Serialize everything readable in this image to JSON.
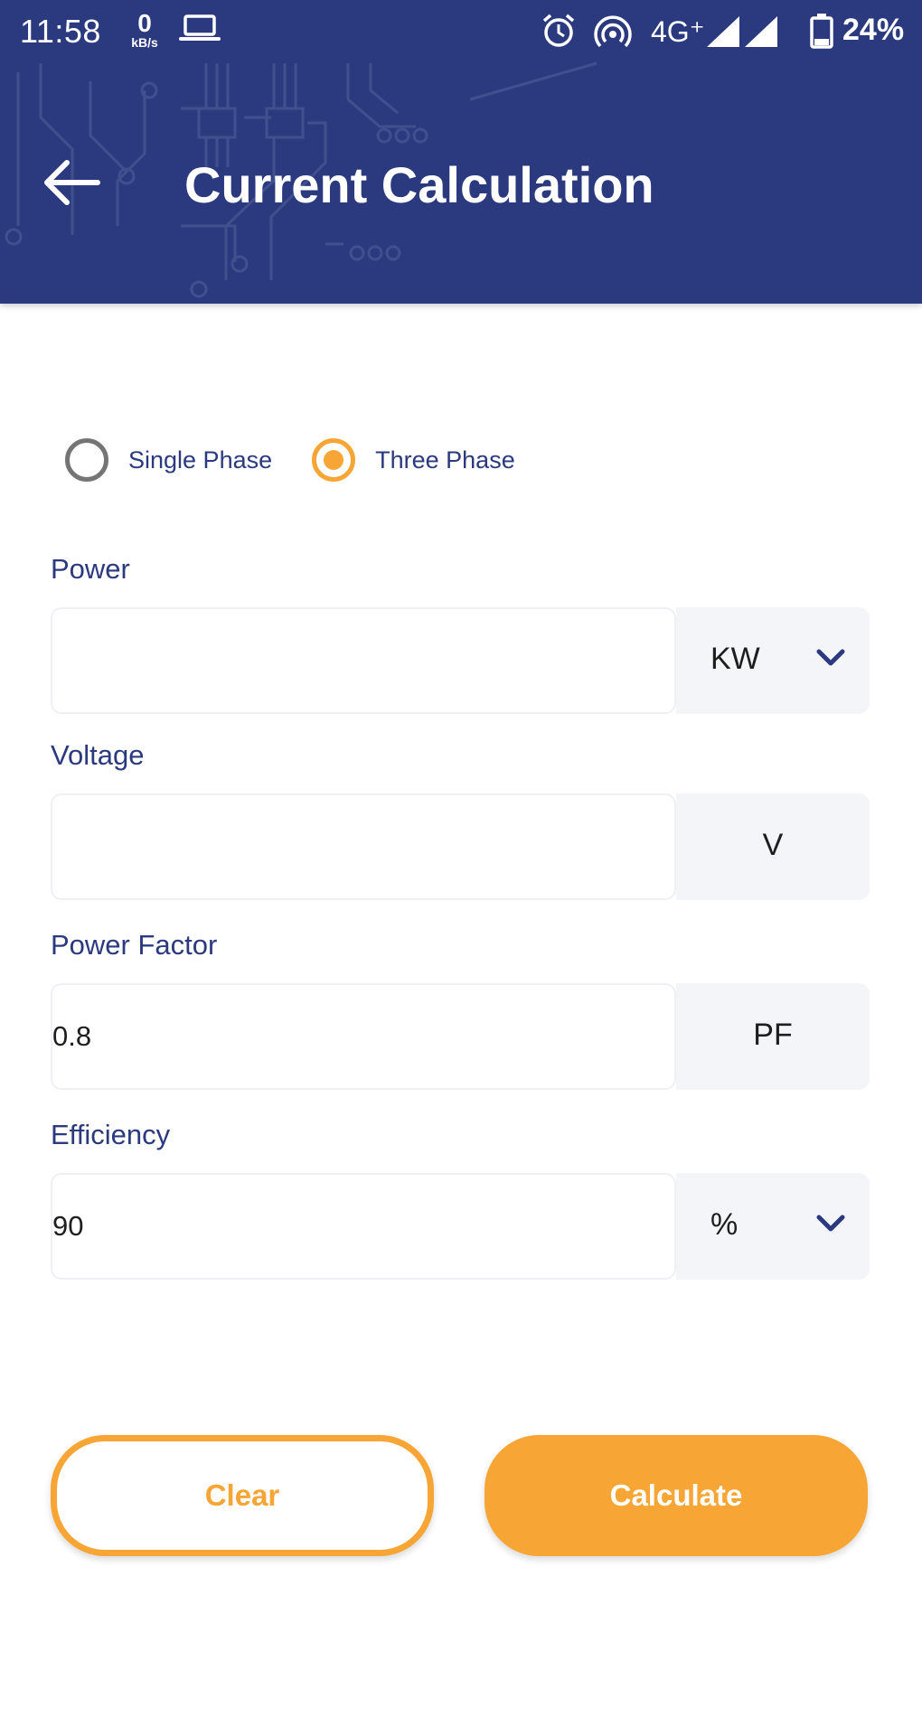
{
  "status_bar": {
    "time": "11:58",
    "speed_value": "0",
    "speed_unit": "kB/s",
    "network": "4G⁺",
    "battery": "24%"
  },
  "app_bar": {
    "title": "Current Calculation",
    "background_color": "#2b3a7e"
  },
  "phase": {
    "options": [
      {
        "label": "Single Phase",
        "selected": false
      },
      {
        "label": "Three Phase",
        "selected": true
      }
    ]
  },
  "fields": {
    "power": {
      "label": "Power",
      "value": "",
      "unit": "KW",
      "unit_dropdown": true
    },
    "voltage": {
      "label": "Voltage",
      "value": "",
      "unit": "V",
      "unit_dropdown": false
    },
    "power_factor": {
      "label": "Power Factor",
      "value": "0.8",
      "unit": "PF",
      "unit_dropdown": false
    },
    "efficiency": {
      "label": "Efficiency",
      "value": "90",
      "unit": "%",
      "unit_dropdown": true
    }
  },
  "actions": {
    "clear_label": "Clear",
    "calculate_label": "Calculate"
  },
  "colors": {
    "accent": "#f7a535",
    "primary": "#2b3a7e",
    "unit_bg": "#f4f5f9"
  }
}
